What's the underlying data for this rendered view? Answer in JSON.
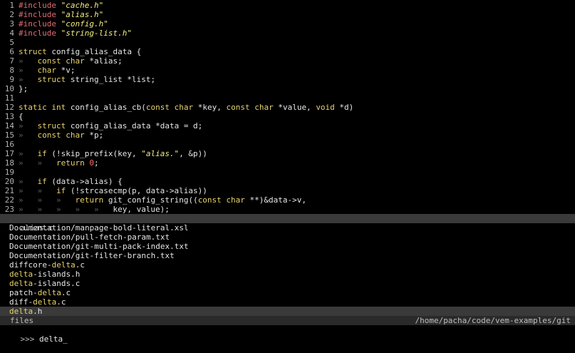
{
  "editor": {
    "lines": [
      {
        "n": "1",
        "segs": [
          [
            "pp",
            "#include "
          ],
          [
            "str",
            "\"cache.h\""
          ]
        ]
      },
      {
        "n": "2",
        "segs": [
          [
            "pp",
            "#include "
          ],
          [
            "str",
            "\"alias.h\""
          ]
        ]
      },
      {
        "n": "3",
        "segs": [
          [
            "pp",
            "#include "
          ],
          [
            "str",
            "\"config.h\""
          ]
        ]
      },
      {
        "n": "4",
        "segs": [
          [
            "pp",
            "#include "
          ],
          [
            "str",
            "\"string-list.h\""
          ]
        ]
      },
      {
        "n": "5",
        "segs": []
      },
      {
        "n": "6",
        "segs": [
          [
            "kw",
            "struct"
          ],
          [
            "plain",
            " config_alias_data {"
          ]
        ]
      },
      {
        "n": "7",
        "segs": [
          [
            "ws",
            "»   "
          ],
          [
            "kw",
            "const"
          ],
          [
            "plain",
            " "
          ],
          [
            "kw",
            "char"
          ],
          [
            "plain",
            " *alias;"
          ]
        ]
      },
      {
        "n": "8",
        "segs": [
          [
            "ws",
            "»   "
          ],
          [
            "kw",
            "char"
          ],
          [
            "plain",
            " *v;"
          ]
        ]
      },
      {
        "n": "9",
        "segs": [
          [
            "ws",
            "»   "
          ],
          [
            "kw",
            "struct"
          ],
          [
            "plain",
            " string_list *list;"
          ]
        ]
      },
      {
        "n": "10",
        "segs": [
          [
            "plain",
            "};"
          ]
        ]
      },
      {
        "n": "11",
        "segs": []
      },
      {
        "n": "12",
        "segs": [
          [
            "kw",
            "static"
          ],
          [
            "plain",
            " "
          ],
          [
            "kw",
            "int"
          ],
          [
            "plain",
            " config_alias_cb("
          ],
          [
            "kw",
            "const"
          ],
          [
            "plain",
            " "
          ],
          [
            "kw",
            "char"
          ],
          [
            "plain",
            " *key, "
          ],
          [
            "kw",
            "const"
          ],
          [
            "plain",
            " "
          ],
          [
            "kw",
            "char"
          ],
          [
            "plain",
            " *value, "
          ],
          [
            "kw",
            "void"
          ],
          [
            "plain",
            " *d)"
          ]
        ]
      },
      {
        "n": "13",
        "segs": [
          [
            "plain",
            "{"
          ]
        ]
      },
      {
        "n": "14",
        "segs": [
          [
            "ws",
            "»   "
          ],
          [
            "kw",
            "struct"
          ],
          [
            "plain",
            " config_alias_data *data = d;"
          ]
        ]
      },
      {
        "n": "15",
        "segs": [
          [
            "ws",
            "»   "
          ],
          [
            "kw",
            "const"
          ],
          [
            "plain",
            " "
          ],
          [
            "kw",
            "char"
          ],
          [
            "plain",
            " *p;"
          ]
        ]
      },
      {
        "n": "16",
        "segs": []
      },
      {
        "n": "17",
        "segs": [
          [
            "ws",
            "»   "
          ],
          [
            "kw",
            "if"
          ],
          [
            "plain",
            " (!skip_prefix(key, "
          ],
          [
            "str",
            "\"alias.\""
          ],
          [
            "plain",
            ", &p))"
          ]
        ]
      },
      {
        "n": "18",
        "segs": [
          [
            "ws",
            "»   »   "
          ],
          [
            "kw",
            "return"
          ],
          [
            "plain",
            " "
          ],
          [
            "num",
            "0"
          ],
          [
            "plain",
            ";"
          ]
        ]
      },
      {
        "n": "19",
        "segs": []
      },
      {
        "n": "20",
        "segs": [
          [
            "ws",
            "»   "
          ],
          [
            "kw",
            "if"
          ],
          [
            "plain",
            " (data->alias) {"
          ]
        ]
      },
      {
        "n": "21",
        "segs": [
          [
            "ws",
            "»   »   "
          ],
          [
            "kw",
            "if"
          ],
          [
            "plain",
            " (!strcasecmp(p, data->alias))"
          ]
        ]
      },
      {
        "n": "22",
        "segs": [
          [
            "ws",
            "»   »   »   "
          ],
          [
            "kw",
            "return"
          ],
          [
            "plain",
            " git_config_string(("
          ],
          [
            "kw",
            "const"
          ],
          [
            "plain",
            " "
          ],
          [
            "kw",
            "char"
          ],
          [
            "plain",
            " **)&data->v,"
          ]
        ]
      },
      {
        "n": "23",
        "segs": [
          [
            "ws",
            "»   »   »   »   »   "
          ],
          [
            "plain",
            "key, value);"
          ]
        ]
      }
    ]
  },
  "status_bar": {
    "filename": "alias.c"
  },
  "file_list": [
    {
      "text": "Documentation/manpage-bold-literal.xsl",
      "hl": ""
    },
    {
      "text": "Documentation/pull-fetch-param.txt",
      "hl": ""
    },
    {
      "text": "Documentation/git-multi-pack-index.txt",
      "hl": ""
    },
    {
      "text": "Documentation/git-filter-branch.txt",
      "hl": ""
    },
    {
      "text": "diffcore-delta.c",
      "hl": "delta"
    },
    {
      "text": "delta-islands.h",
      "hl": "delta"
    },
    {
      "text": "delta-islands.c",
      "hl": "delta"
    },
    {
      "text": "patch-delta.c",
      "hl": "delta"
    },
    {
      "text": "diff-delta.c",
      "hl": "delta"
    },
    {
      "text": "delta.h",
      "hl": "delta",
      "selected": true
    }
  ],
  "footer": {
    "label": "files",
    "path": "/home/pacha/code/vem-examples/git"
  },
  "prompt": {
    "symbol": ">>> ",
    "query": "delta",
    "cursor": "_"
  },
  "colors": {
    "keyword": "#e8d36b",
    "string": "#f2ed86",
    "preproc": "#e06c75",
    "number": "#ff6b6b"
  }
}
